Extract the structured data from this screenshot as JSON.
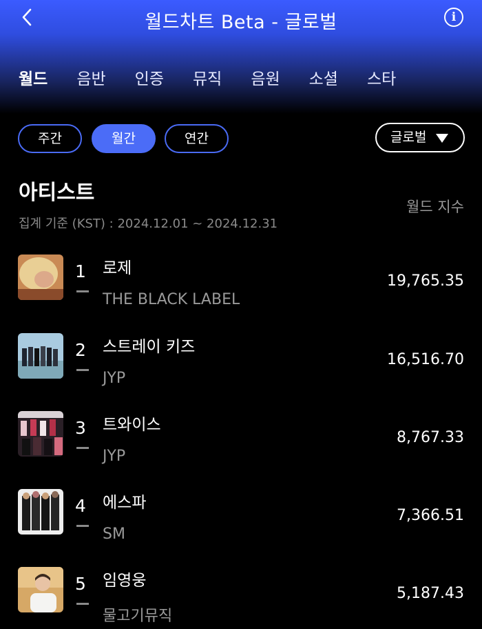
{
  "header": {
    "title": "월드차트 Beta - 글로벌",
    "back_icon": "chevron-left-icon",
    "info_icon": "info-icon",
    "info_glyph": "i"
  },
  "tabs": [
    "월드",
    "음반",
    "인증",
    "뮤직",
    "음원",
    "소셜",
    "스타"
  ],
  "active_tab": "월드",
  "periods": [
    "주간",
    "월간",
    "연간"
  ],
  "active_period": "월간",
  "region_select": {
    "value": "글로벌"
  },
  "section": {
    "title": "아티스트",
    "metric_label": "월드 지수",
    "period_text": "집계 기준 (KST) : 2024.12.01 ~ 2024.12.31"
  },
  "rankings": [
    {
      "rank": "1",
      "name": "로제",
      "agency": "THE BLACK LABEL",
      "score": "19,765.35",
      "change": "—"
    },
    {
      "rank": "2",
      "name": "스트레이 키즈",
      "agency": "JYP",
      "score": "16,516.70",
      "change": "—"
    },
    {
      "rank": "3",
      "name": "트와이스",
      "agency": "JYP",
      "score": "8,767.33",
      "change": "—"
    },
    {
      "rank": "4",
      "name": "에스파",
      "agency": "SM",
      "score": "7,366.51",
      "change": "—"
    },
    {
      "rank": "5",
      "name": "임영웅",
      "agency": "물고기뮤직",
      "score": "5,187.43",
      "change": "—"
    }
  ],
  "colors": {
    "accent": "#4b6cf7",
    "header_gradient_top": "#3b5bff",
    "background": "#000000",
    "muted_text": "#9a9a9a"
  }
}
